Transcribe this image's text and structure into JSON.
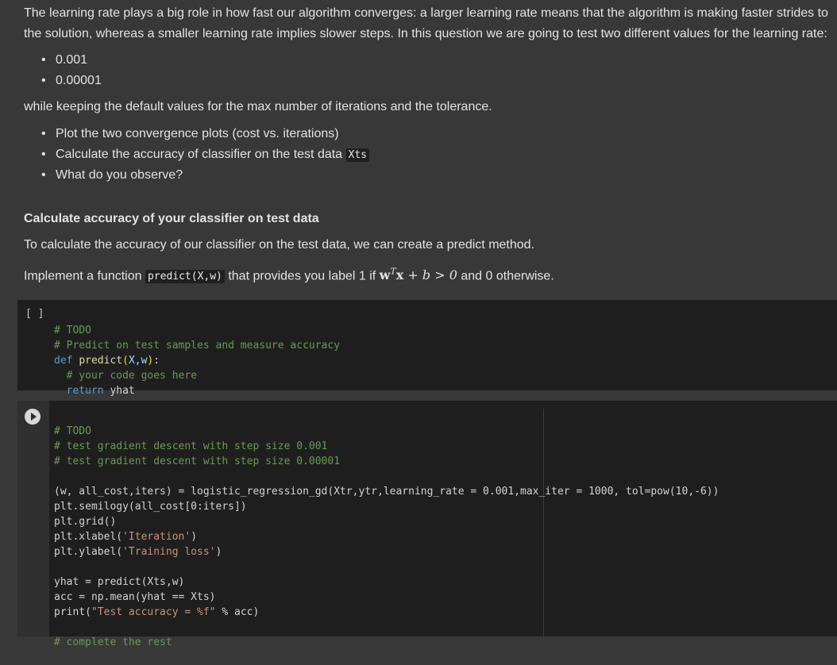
{
  "intro": {
    "line1": "The learning rate plays a big role in how fast our algorithm converges: a larger learning rate means that the algorithm is making faster strides to",
    "line2": "the solution, whereas a smaller learning rate implies slower steps. In this question we are going to test two different values for the learning rate:"
  },
  "rates": [
    "0.001",
    "0.00001"
  ],
  "defaults_text": "while keeping the default values for the max number of iterations and the tolerance.",
  "tasks": {
    "t1": "Plot the two convergence plots (cost vs. iterations)",
    "t2": "Calculate the accuracy of classifier on the test data ",
    "t2_code": "Xts",
    "t3": "What do you observe?"
  },
  "heading": "Calculate accuracy of your classifier on test data",
  "para1": "To calculate the accuracy of our classifier on the test data, we can create a predict method.",
  "para2": {
    "pre": "Implement a function ",
    "code": "predict(X,w)",
    "mid": " that provides you label 1 if ",
    "post": " and 0 otherwise."
  },
  "cell1": {
    "exec_label": "[ ]",
    "l1": "# TODO",
    "l2": "# Predict on test samples and measure accuracy",
    "l3_kw": "def",
    "l3_fn": "predict",
    "l3_args": "X,w",
    "l4": "# your code goes here",
    "l5_kw": "return",
    "l5_rest": " yhat"
  },
  "cell2": {
    "l1": "# TODO",
    "l2": "# test gradient descent with step size 0.001",
    "l3": "# test gradient descent with step size 0.00001",
    "l5": "(w, all_cost,iters) = logistic_regression_gd(Xtr,ytr,learning_rate = 0.001,max_iter = 1000, tol=pow(10,-6))",
    "l6": "plt.semilogy(all_cost[0:iters])",
    "l7": "plt.grid()",
    "l8a": "plt.xlabel(",
    "l8s": "'Iteration'",
    "l8b": ")",
    "l9a": "plt.ylabel(",
    "l9s": "'Training loss'",
    "l9b": ")",
    "l11": "yhat = predict(Xts,w)",
    "l12": "acc = np.mean(yhat == Xts)",
    "l13a": "print(",
    "l13s": "\"Test accuracy = %f\"",
    "l13b": " % acc)",
    "l15": "# complete the rest"
  }
}
